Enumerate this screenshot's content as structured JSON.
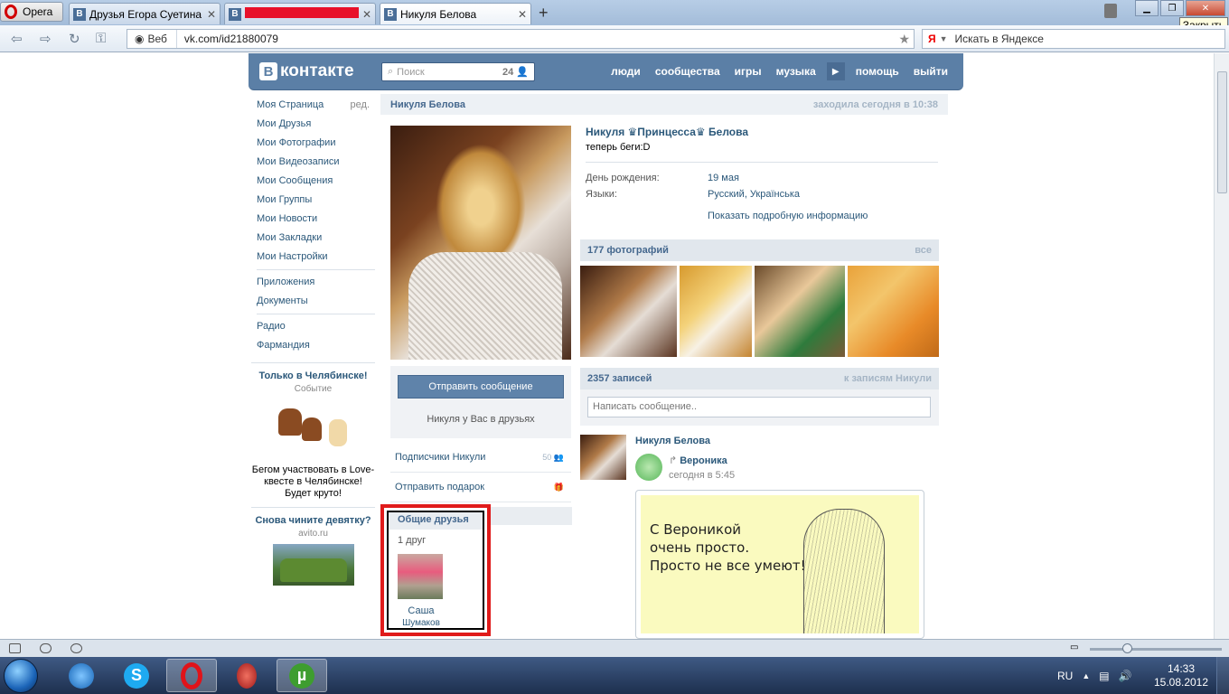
{
  "browser": {
    "opera_label": "Opera",
    "tabs": [
      {
        "title": "Друзья Егора Суетина ...",
        "favicon": "В"
      },
      {
        "title": "",
        "favicon": "В",
        "redacted": true
      },
      {
        "title": "Никуля Белова",
        "favicon": "В"
      }
    ],
    "tooltip": "Закрыть",
    "address": {
      "mode": "Веб",
      "url": "vk.com/id21880079"
    },
    "search_placeholder": "Искать в Яндексе",
    "search_engine_glyph": "Я"
  },
  "vk": {
    "logo_text": "контакте",
    "logo_letter": "В",
    "search_placeholder": "Поиск",
    "search_count": "24",
    "nav": [
      "люди",
      "сообщества",
      "игры",
      "музыка",
      "помощь",
      "выйти"
    ]
  },
  "left_menu": {
    "edit_label": "ред.",
    "group1": [
      "Моя Страница",
      "Мои Друзья",
      "Мои Фотографии",
      "Мои Видеозаписи",
      "Мои Сообщения",
      "Мои Группы",
      "Мои Новости",
      "Мои Закладки",
      "Мои Настройки"
    ],
    "group2": [
      "Приложения",
      "Документы"
    ],
    "group3": [
      "Радио",
      "Фармандия"
    ]
  },
  "ads": [
    {
      "title": "Только в Челябинске!",
      "subtitle": "Событие",
      "text": "Бегом участвовать в Love-квесте в Челябинске! Будет круто!"
    },
    {
      "title": "Снова чините девятку?",
      "subtitle": "avito.ru"
    }
  ],
  "profile": {
    "header_name": "Никуля Белова",
    "last_seen": "заходила сегодня в 10:38",
    "full_name": "Никуля ♛Принцесса♛ Белова",
    "status": "теперь беги:D",
    "info": [
      {
        "key": "День рождения:",
        "value": "19 мая"
      },
      {
        "key": "Языки:",
        "value": "Русский, Українська"
      }
    ],
    "more_info": "Показать подробную информацию",
    "send_message": "Отправить сообщение",
    "in_friends": "Никуля у Вас в друзьях",
    "followers_label": "Подписчики Никули",
    "followers_count": "50",
    "gift_label": "Отправить подарок",
    "mutual": {
      "title": "Общие друзья",
      "count": "1 друг",
      "friend_first": "Саша",
      "friend_last": "Шумаков"
    },
    "photos": {
      "title": "177 фотографий",
      "all": "все"
    },
    "wall": {
      "title": "2357 записей",
      "link": "к записям Никули",
      "placeholder": "Написать сообщение.."
    },
    "post": {
      "author": "Никуля Белова",
      "repost_from": "Вероника",
      "time": "сегодня в 5:45",
      "image_text": [
        "С Вероникой",
        "очень просто.",
        "Просто не все умеют!"
      ]
    }
  },
  "taskbar": {
    "lang": "RU",
    "time": "14:33",
    "date": "15.08.2012"
  },
  "colors": {
    "vk_blue": "#5b7fa6",
    "link": "#2b587a",
    "highlight_border": "#e01b1b"
  }
}
